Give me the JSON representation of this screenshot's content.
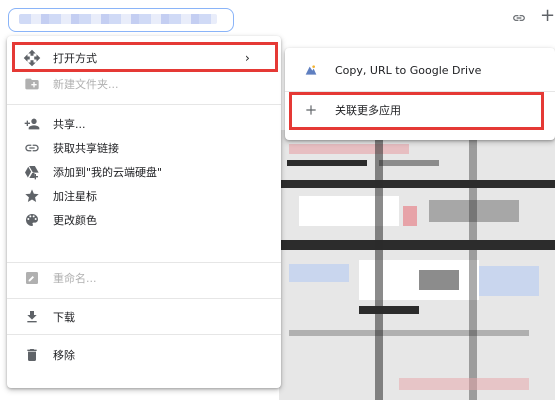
{
  "context_menu": {
    "items": [
      {
        "label": "打开方式",
        "icon": "open-with-icon",
        "has_submenu": true
      },
      {
        "label": "新建文件夹...",
        "icon": "new-folder-icon",
        "disabled": true
      },
      {
        "label": "共享...",
        "icon": "person-add-icon"
      },
      {
        "label": "获取共享链接",
        "icon": "link-icon"
      },
      {
        "label": "添加到\"我的云端硬盘\"",
        "icon": "drive-add-icon"
      },
      {
        "label": "加注星标",
        "icon": "star-icon"
      },
      {
        "label": "更改颜色",
        "icon": "palette-icon"
      },
      {
        "label": "重命名...",
        "icon": "rename-icon",
        "disabled": true
      },
      {
        "label": "下载",
        "icon": "download-icon"
      },
      {
        "label": "移除",
        "icon": "trash-icon"
      }
    ]
  },
  "submenu": {
    "items": [
      {
        "label": "Copy, URL to Google Drive",
        "icon": "app-icon"
      },
      {
        "label": "关联更多应用",
        "icon": "plus-icon"
      }
    ]
  },
  "colors": {
    "highlight": "#e53935",
    "icon": "#5f6368",
    "disabled": "#b0b0b0"
  }
}
